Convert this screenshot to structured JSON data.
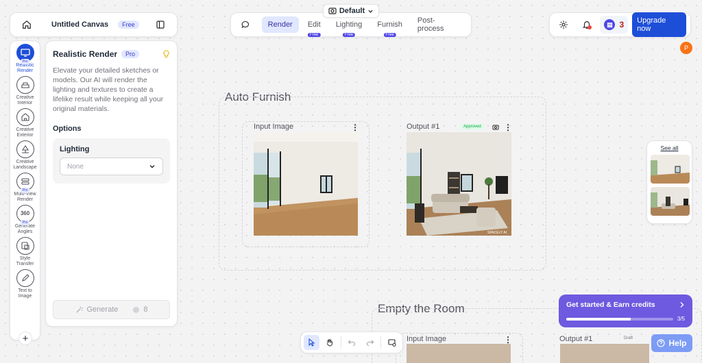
{
  "header": {
    "canvas_title": "Untitled Canvas",
    "plan_badge": "Free",
    "preset": "Default",
    "tabs": [
      {
        "label": "Render",
        "free": ""
      },
      {
        "label": "Edit",
        "free": "Free"
      },
      {
        "label": "Lighting",
        "free": "Free"
      },
      {
        "label": "Furnish",
        "free": "Free"
      },
      {
        "label": "Post-process",
        "free": ""
      }
    ],
    "credits": "3",
    "upgrade_label": "Upgrade now",
    "avatar_initial": "P"
  },
  "tool_rail": [
    {
      "label": "Realistic Render",
      "pro": "Pro"
    },
    {
      "label": "Creative Interior",
      "pro": ""
    },
    {
      "label": "Creative Exterior",
      "pro": ""
    },
    {
      "label": "Creative Landscape",
      "pro": ""
    },
    {
      "label": "Multi-View Render",
      "pro": "Pro"
    },
    {
      "label": "Generate Angles",
      "pro": "Pro"
    },
    {
      "label": "Style Transfer",
      "pro": ""
    },
    {
      "label": "Text to Image",
      "pro": ""
    }
  ],
  "settings": {
    "title": "Realistic Render",
    "badge": "Pro",
    "description": "Elevate your detailed sketches or models. Our AI will render the lighting and textures to create a lifelike result while keeping all your original materials.",
    "options_heading": "Options",
    "lighting_label": "Lighting",
    "lighting_value": "None",
    "generate_label": "Generate",
    "generate_cost": "8"
  },
  "canvas": {
    "group1_title": "Auto Furnish",
    "input_label": "Input Image",
    "output_label": "Output #1",
    "output_status": "Approved",
    "watermark": "SPACELY AI",
    "group2_title": "Empty the Room",
    "group2_input_label": "Input Image",
    "group2_output_label": "Output #1",
    "group2_output_status": "Draft",
    "360_glyph": "360"
  },
  "history": {
    "see_all": "See all"
  },
  "onboarding": {
    "title": "Get started & Earn credits",
    "progress_text": "3/5",
    "progress": 0.6
  },
  "help_label": "Help",
  "colors": {
    "accent": "#1d4ed8",
    "onboard": "#6d5ae0",
    "approved": "#22c55e"
  }
}
